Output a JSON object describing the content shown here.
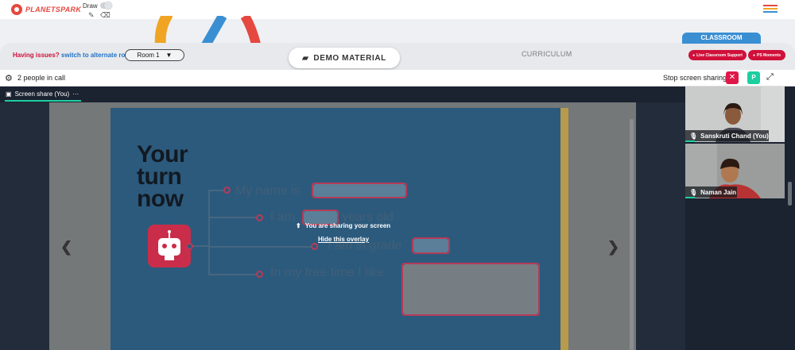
{
  "header": {
    "logo_text": "PLANETSPARK",
    "draw_label": "Draw",
    "menu_colors": [
      "#e5483f",
      "#f0a424",
      "#3a8fd3"
    ]
  },
  "toolbar": {
    "issues_text": "Having issues?",
    "issues_link": "switch to alternate room",
    "room_value": "Room 1",
    "demo_label": "DEMO MATERIAL",
    "curriculum_label": "CURRICULUM",
    "classroom_tab": "CLASSROOM",
    "support_label": "Live Classroom Support",
    "moments_label": "PS Moments"
  },
  "call": {
    "people_count": "2 people in call",
    "stop_label": "Stop screen sharing",
    "presenter_initial": "P"
  },
  "share": {
    "tab_label": "Screen share (You)",
    "overlay_text": "You are sharing your screen",
    "hide_overlay": "Hide this overlay"
  },
  "slide": {
    "title_lines": [
      "Your",
      "turn",
      "now"
    ],
    "line_1": "My name is",
    "line_2a": "I am",
    "line_2b": "years old",
    "line_3": "I am in grade",
    "line_4": "In my free time I like"
  },
  "participants": [
    {
      "name": "Sanskruti Chand (You)"
    },
    {
      "name": "Naman Jain"
    }
  ],
  "colors": {
    "accent_red": "#d0103a",
    "accent_teal": "#1ccfa0",
    "accent_blue": "#3a8fd3"
  }
}
